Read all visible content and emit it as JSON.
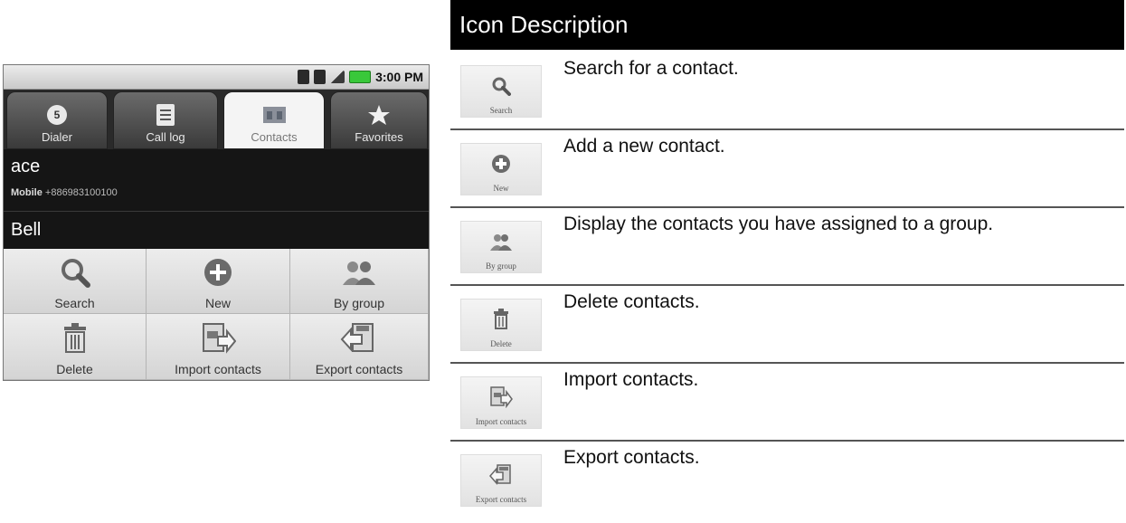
{
  "phone": {
    "status_bar": {
      "time": "3:00 PM"
    },
    "tabs": [
      {
        "label": "Dialer",
        "icon": "dialer-icon",
        "badge": "5",
        "selected": false
      },
      {
        "label": "Call log",
        "icon": "call-log-icon",
        "selected": false
      },
      {
        "label": "Contacts",
        "icon": "contacts-icon",
        "selected": true
      },
      {
        "label": "Favorites",
        "icon": "star-icon",
        "selected": false
      }
    ],
    "contacts": [
      {
        "name": "ace",
        "number_type": "Mobile",
        "number": "+886983100100"
      },
      {
        "name": "Bell"
      }
    ],
    "menu": [
      {
        "label": "Search",
        "icon": "search-icon"
      },
      {
        "label": "New",
        "icon": "add-icon"
      },
      {
        "label": "By group",
        "icon": "group-icon"
      },
      {
        "label": "Delete",
        "icon": "trash-icon"
      },
      {
        "label": "Import contacts",
        "icon": "import-icon"
      },
      {
        "label": "Export contacts",
        "icon": "export-icon"
      }
    ]
  },
  "description_table": {
    "header": "Icon Description",
    "rows": [
      {
        "icon_label": "Search",
        "icon": "search-icon",
        "description": "Search for a contact."
      },
      {
        "icon_label": "New",
        "icon": "add-icon",
        "description": "Add a new contact."
      },
      {
        "icon_label": "By group",
        "icon": "group-icon",
        "description": "Display the contacts you have assigned to a group."
      },
      {
        "icon_label": "Delete",
        "icon": "trash-icon",
        "description": "Delete contacts."
      },
      {
        "icon_label": "Import contacts",
        "icon": "import-icon",
        "description": "Import contacts."
      },
      {
        "icon_label": "Export contacts",
        "icon": "export-icon",
        "description": "Export contacts."
      }
    ]
  },
  "colors": {
    "header_bg": "#000000",
    "battery": "#39c83a"
  }
}
